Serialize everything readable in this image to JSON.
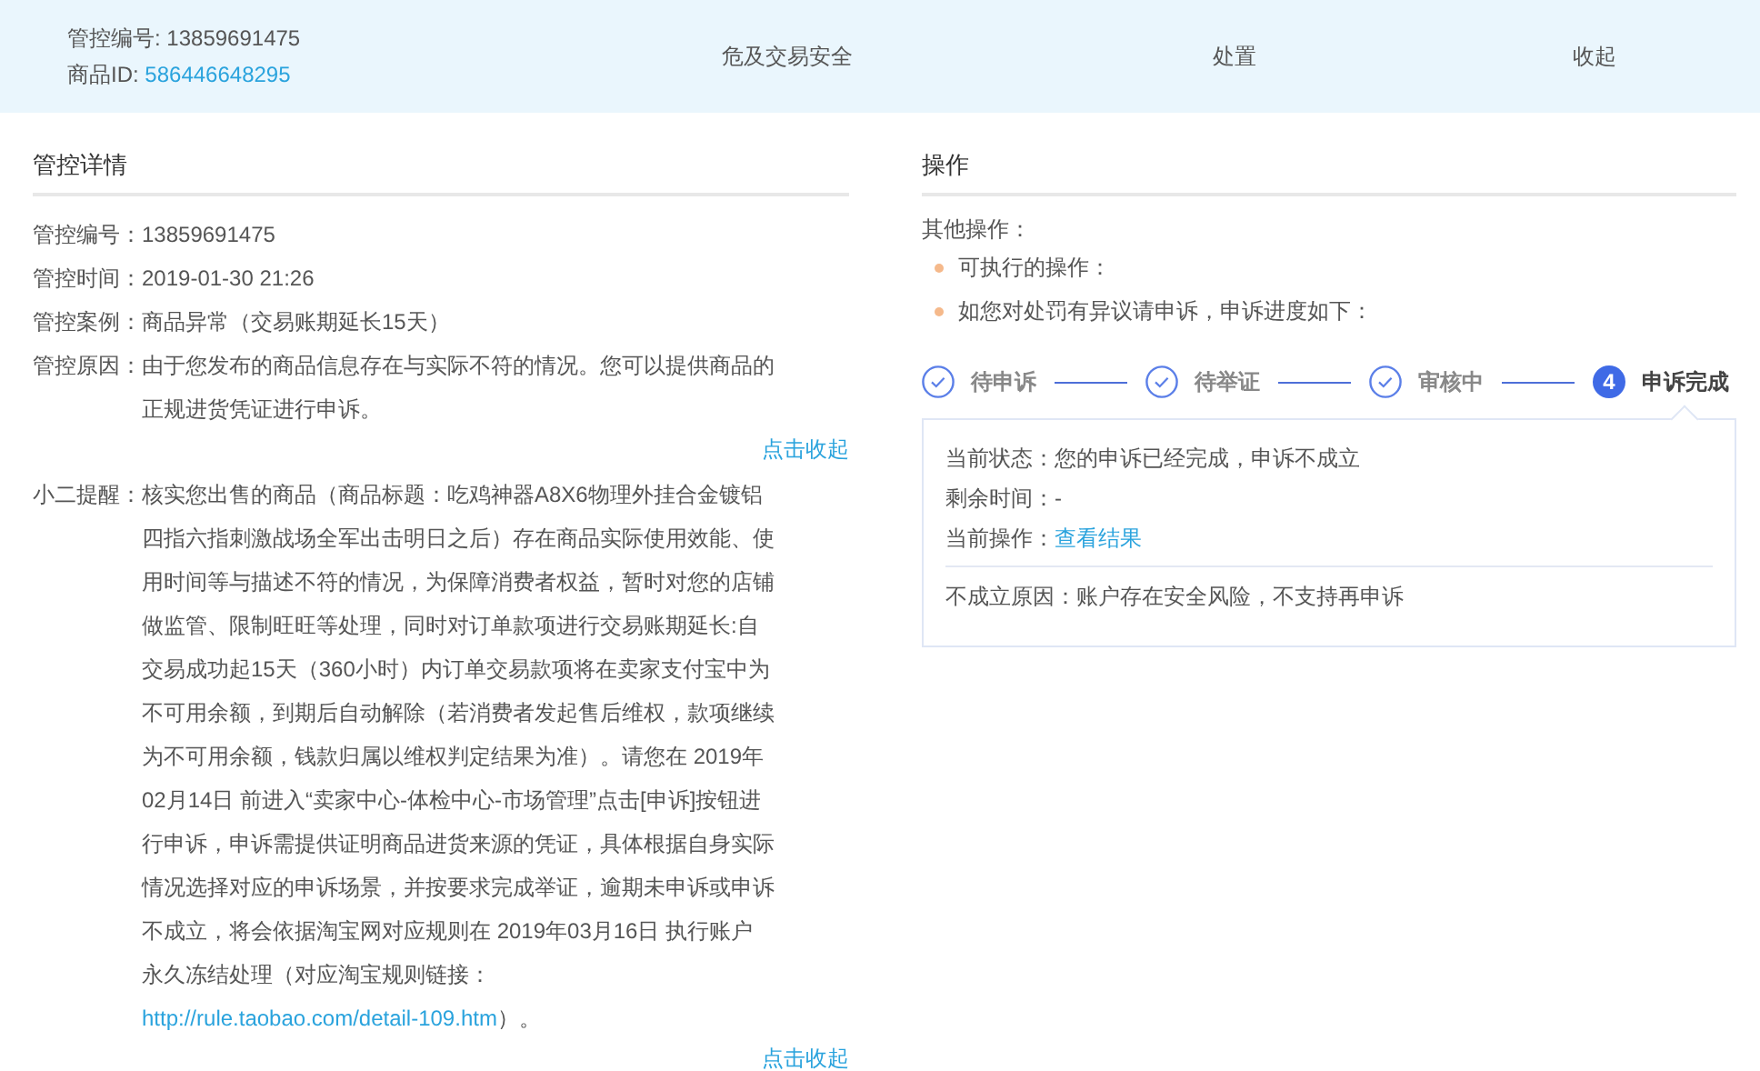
{
  "header": {
    "control_id_label": "管控编号:",
    "control_id": "13859691475",
    "product_id_label": "商品ID:",
    "product_id": "586446648295",
    "risk": "危及交易安全",
    "action": "处置",
    "collapse": "收起"
  },
  "details": {
    "title": "管控详情",
    "rows": [
      {
        "label": "管控编号：",
        "value": "13859691475"
      },
      {
        "label": "管控时间：",
        "value": "2019-01-30 21:26"
      },
      {
        "label": "管控案例：",
        "value": "商品异常（交易账期延长15天）"
      },
      {
        "label": "管控原因：",
        "value": "由于您发布的商品信息存在与实际不符的情况。您可以提供商品的正规进货凭证进行申诉。"
      }
    ],
    "collapse_1": "点击收起",
    "reminder": {
      "label": "小二提醒：",
      "text_before": "核实您出售的商品（商品标题：吃鸡神器A8X6物理外挂合金镀铝四指六指刺激战场全军出击明日之后）存在商品实际使用效能、使用时间等与描述不符的情况，为保障消费者权益，暂时对您的店铺做监管、限制旺旺等处理，同时对订单款项进行交易账期延长:自交易成功起15天（360小时）内订单交易款项将在卖家支付宝中为不可用余额，到期后自动解除（若消费者发起售后维权，款项继续为不可用余额，钱款归属以维权判定结果为准）。请您在 2019年02月14日 前进入“卖家中心-体检中心-市场管理”点击[申诉]按钮进行申诉，申诉需提供证明商品进货来源的凭证，具体根据自身实际情况选择对应的申诉场景，并按要求完成举证，逾期未申诉或申诉不成立，将会依据淘宝网对应规则在 2019年03月16日 执行账户永久冻结处理（对应淘宝规则链接：",
      "link": "http://rule.taobao.com/detail-109.htm",
      "text_after": "）。"
    },
    "collapse_2": "点击收起"
  },
  "operations": {
    "title": "操作",
    "other_label": "其他操作：",
    "bullets": [
      "可执行的操作：",
      "如您对处罚有异议请申诉，申诉进度如下："
    ],
    "steps": [
      {
        "label": "待申诉",
        "done": true
      },
      {
        "label": "待举证",
        "done": true
      },
      {
        "label": "审核中",
        "done": true
      },
      {
        "number": "4",
        "label": "申诉完成",
        "done": false
      }
    ],
    "result": {
      "status_label": "当前状态：",
      "status": "您的申诉已经完成，申诉不成立",
      "time_label": "剩余时间：",
      "time": "-",
      "action_label": "当前操作：",
      "action_link": "查看结果",
      "reason_label": "不成立原因：",
      "reason": "账户存在安全风险，不支持再申诉"
    }
  }
}
